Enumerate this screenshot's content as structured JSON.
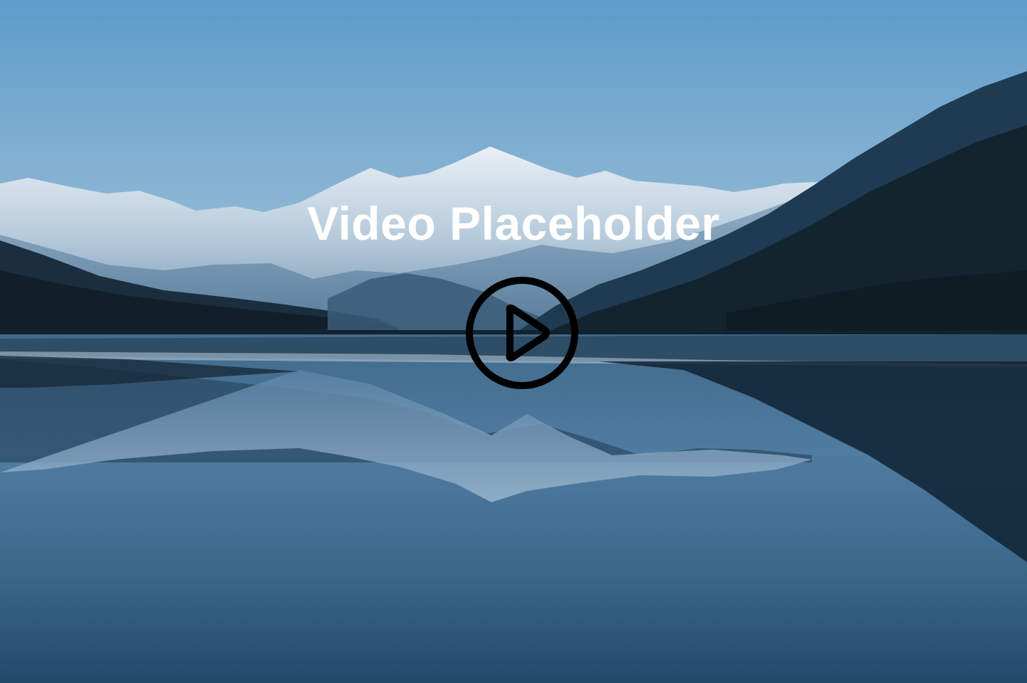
{
  "video": {
    "title": "Video Placeholder",
    "play_icon": "play-circle-icon",
    "play_color": "#000000"
  },
  "background": {
    "scene_icon": "mountain-lake-image",
    "sky_top": "#5f9bc9",
    "sky_bottom": "#9dbdd1",
    "water_dark": "#1e4260"
  }
}
